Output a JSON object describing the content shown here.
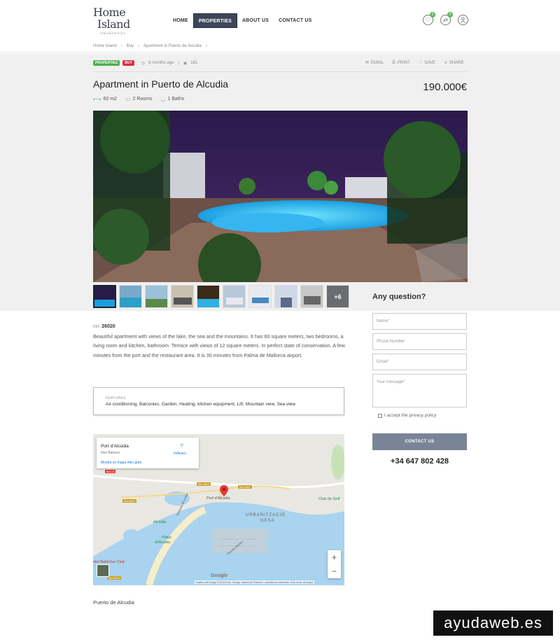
{
  "header": {
    "logo_line1": "Home",
    "logo_line2": "Island",
    "logo_sub": "PROPERTIES",
    "nav": [
      {
        "label": "HOME"
      },
      {
        "label": "PROPERTIES"
      },
      {
        "label": "ABOUT US"
      },
      {
        "label": "CONTACT US"
      }
    ],
    "favorites_count": "0",
    "compare_count": "0"
  },
  "breadcrumb": [
    "Home Island",
    "Buy",
    "Apartment in Puerto de Alcudia"
  ],
  "listing": {
    "tag_category": "PROPERTIES",
    "tag_status": "BUY",
    "posted": "6 months ago",
    "views": "181",
    "actions": {
      "email": "EMAIL",
      "print": "PRINT",
      "save": "SAVE",
      "share": "SHARE"
    },
    "title": "Apartment in Puerto de Alcudia",
    "price": "190.000€",
    "area": "60 m2",
    "rooms": "2 Rooms",
    "baths": "1 Baths",
    "more_photos": "+6",
    "ref_label": "REF.",
    "ref": "26020",
    "description": "Beautiful apartment with views of the lake, the sea and the mountains. It has 60 square meters, two bedrooms, a living room and kitchen, bathroom. Terrace with views of 12 square meters. In perfect state of conservation. A few minutes from the port and the restaurant area. It is 30 minutes from Palma de Mallorca airport.",
    "features_label": "FEATURES",
    "features": "Air conditioning, Balconies, Garden, Heating, kitchen equipment, Lift, Mountain view, Sea view",
    "location": "Puerto de Alcudia"
  },
  "contact_form": {
    "heading": "Any question?",
    "name_placeholder": "Name*",
    "phone_placeholder": "Phone Number",
    "email_placeholder": "Email*",
    "message_placeholder": "Your message*",
    "privacy": "I accept the privacy policy",
    "submit": "CONTACT US",
    "phone": "+34 647 802 428"
  },
  "map": {
    "place_name": "Port d'Alcúdia",
    "region": "Illes Balears",
    "bigger_map": "Mostra un mapa més gran",
    "directions": "Indicaci...",
    "labels": {
      "port": "Port d'Alcúdia",
      "urbanitzacio": "URBANITZACIÓ",
      "gesa": "GESA",
      "alcudia": "Alcúdia",
      "platja1": "Platja",
      "platja2": "d'Alcúdia",
      "club_golf": "Club de Golf",
      "hotel": "otel BelleVue Club",
      "road1": "Ma-13",
      "road2": "Ma-3460",
      "road3": "Ma-3460",
      "road4": "Ma-3470",
      "road5": "Ma-3460",
      "street": "Avinguda de la Mar",
      "passeig": "Passeig Marítim"
    },
    "footer": "Dades del mapa ©2022 Inst. Geogr. Nacional    Termes i condicions    Informeu d'un error al mapa",
    "google": "Google",
    "zoom_in": "+",
    "zoom_out": "−"
  },
  "watermark": "ayudaweb.es",
  "colors": {
    "nav_active": "#3e4659",
    "tag_green": "#4caf50",
    "tag_red": "#d9303a",
    "contact_button": "#7a8498"
  }
}
